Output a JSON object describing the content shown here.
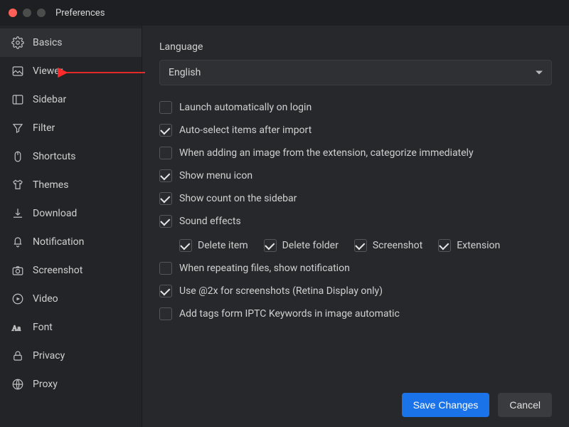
{
  "window": {
    "title": "Preferences"
  },
  "sidebar": {
    "items": [
      {
        "label": "Basics"
      },
      {
        "label": "Viewer"
      },
      {
        "label": "Sidebar"
      },
      {
        "label": "Filter"
      },
      {
        "label": "Shortcuts"
      },
      {
        "label": "Themes"
      },
      {
        "label": "Download"
      },
      {
        "label": "Notification"
      },
      {
        "label": "Screenshot"
      },
      {
        "label": "Video"
      },
      {
        "label": "Font"
      },
      {
        "label": "Privacy"
      },
      {
        "label": "Proxy"
      }
    ],
    "activeIndex": 0
  },
  "main": {
    "languageLabel": "Language",
    "languageValue": "English",
    "checks": [
      {
        "label": "Launch automatically on login",
        "checked": false
      },
      {
        "label": "Auto-select items after import",
        "checked": true
      },
      {
        "label": "When adding an image from the extension, categorize immediately",
        "checked": false
      },
      {
        "label": "Show menu icon",
        "checked": true
      },
      {
        "label": "Show count on the sidebar",
        "checked": true
      },
      {
        "label": "Sound effects",
        "checked": true,
        "sub": [
          {
            "label": "Delete item",
            "checked": true
          },
          {
            "label": "Delete folder",
            "checked": true
          },
          {
            "label": "Screenshot",
            "checked": true
          },
          {
            "label": "Extension",
            "checked": true
          }
        ]
      },
      {
        "label": "When repeating files, show notification",
        "checked": false
      },
      {
        "label": "Use @2x for screenshots (Retina Display only)",
        "checked": true
      },
      {
        "label": "Add tags form IPTC Keywords in image automatic",
        "checked": false
      }
    ]
  },
  "footer": {
    "save": "Save Changes",
    "cancel": "Cancel"
  },
  "colors": {
    "accent": "#1a73e8",
    "annotation": "#ff2a2a"
  }
}
